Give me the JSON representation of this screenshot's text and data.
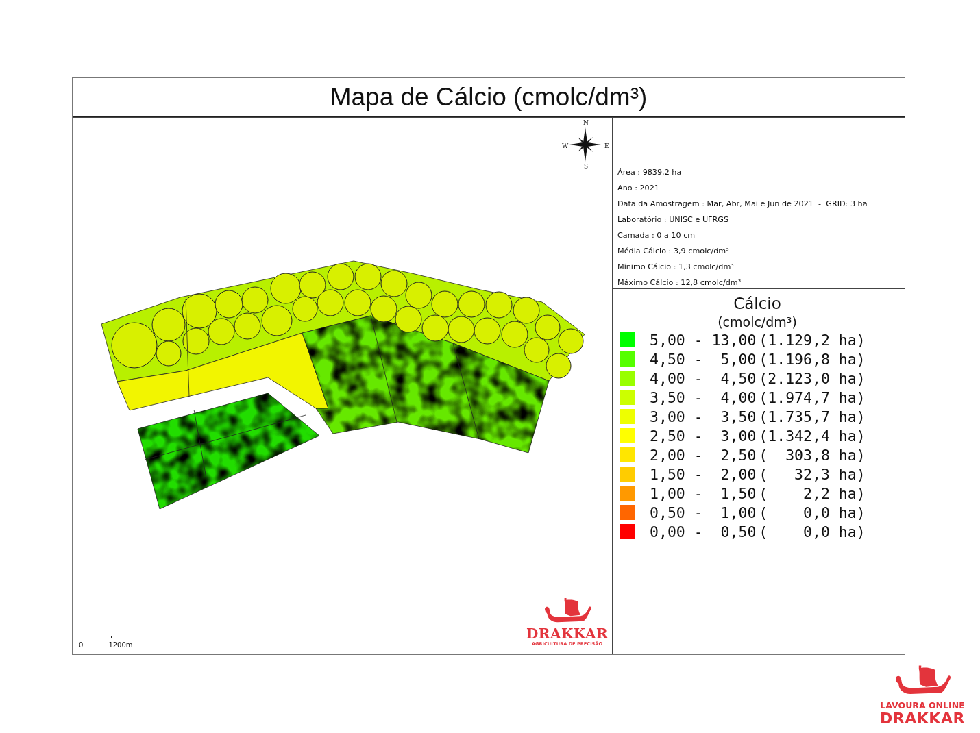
{
  "title": "Mapa de Cálcio (cmolc/dm³)",
  "map": {
    "compass": {
      "north": "N",
      "east": "E",
      "south": "S",
      "west": "W"
    },
    "scale_bar": {
      "start": "0",
      "end": "1200m"
    },
    "logo": {
      "name": "DRAKKAR",
      "tagline": "AGRICULTURA DE PRECISÃO"
    }
  },
  "info": [
    "Área : 9839,2 ha",
    "Ano : 2021",
    "Data da Amostragem : Mar, Abr, Mai e Jun de 2021  -  GRID: 3 ha",
    "Laboratório : UNISC e UFRGS",
    "Camada : 0 a 10 cm",
    "Média Cálcio : 3,9 cmolc/dm³",
    "Mínimo Cálcio : 1,3 cmolc/dm³",
    "Máximo Cálcio : 12,8 cmolc/dm³"
  ],
  "legend": {
    "title": "Cálcio",
    "unit": "(cmolc/dm³)",
    "classes": [
      {
        "range": "5,00 - 13,00",
        "area": "(1.129,2 ha)",
        "color": "#00ff00"
      },
      {
        "range": "4,50 -  5,00",
        "area": "(1.196,8 ha)",
        "color": "#55ff00"
      },
      {
        "range": "4,00 -  4,50",
        "area": "(2.123,0 ha)",
        "color": "#99ff00"
      },
      {
        "range": "3,50 -  4,00",
        "area": "(1.974,7 ha)",
        "color": "#ccff00"
      },
      {
        "range": "3,00 -  3,50",
        "area": "(1.735,7 ha)",
        "color": "#eeff00"
      },
      {
        "range": "2,50 -  3,00",
        "area": "(1.342,4 ha)",
        "color": "#ffff00"
      },
      {
        "range": "2,00 -  2,50",
        "area": "(  303,8 ha)",
        "color": "#ffe600"
      },
      {
        "range": "1,50 -  2,00",
        "area": "(   32,3 ha)",
        "color": "#ffcc00"
      },
      {
        "range": "1,00 -  1,50",
        "area": "(    2,2 ha)",
        "color": "#ff9900"
      },
      {
        "range": "0,50 -  1,00",
        "area": "(    0,0 ha)",
        "color": "#ff6600"
      },
      {
        "range": "0,00 -  0,50",
        "area": "(    0,0 ha)",
        "color": "#ff0000"
      }
    ]
  },
  "brand": {
    "line1": "LAVOURA ONLINE",
    "line2": "DRAKKAR"
  }
}
